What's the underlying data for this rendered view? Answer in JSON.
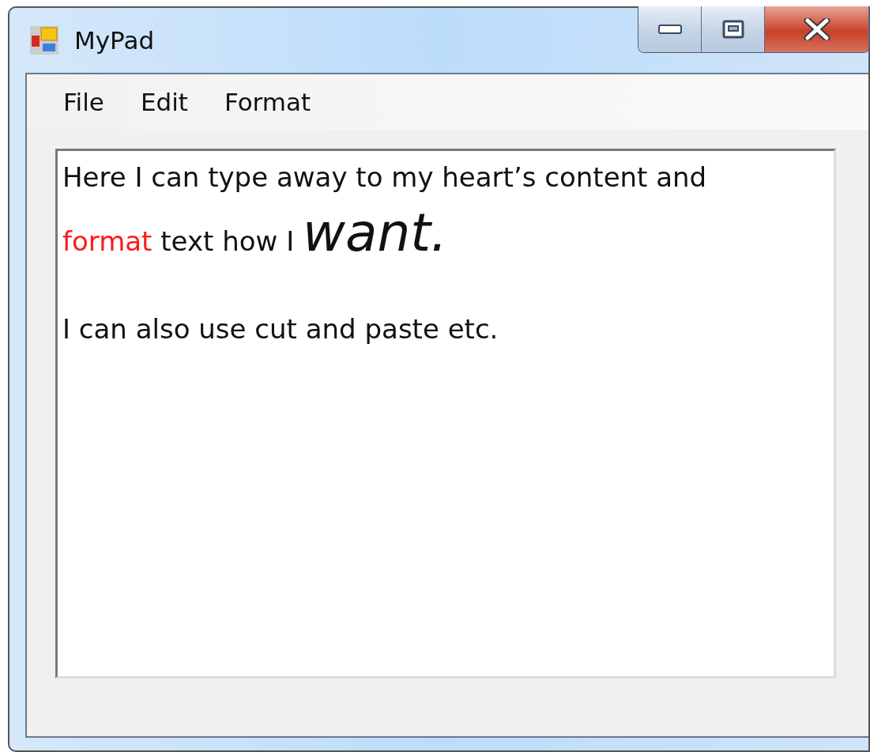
{
  "window": {
    "title": "MyPad"
  },
  "menu": [
    {
      "label": "File"
    },
    {
      "label": "Edit"
    },
    {
      "label": "Format"
    }
  ],
  "document": {
    "paragraphs": [
      {
        "lines": [
          [
            {
              "text": "Here I can type away to my heart’s content and",
              "kind": "normal"
            }
          ],
          [
            {
              "text": "format",
              "kind": "red"
            },
            {
              "text": " text how I ",
              "kind": "normal"
            },
            {
              "text": "want.",
              "kind": "emphasis"
            }
          ]
        ]
      },
      {
        "lines": [
          [
            {
              "text": "I can also use cut and paste etc.",
              "kind": "normal"
            }
          ]
        ]
      }
    ]
  }
}
